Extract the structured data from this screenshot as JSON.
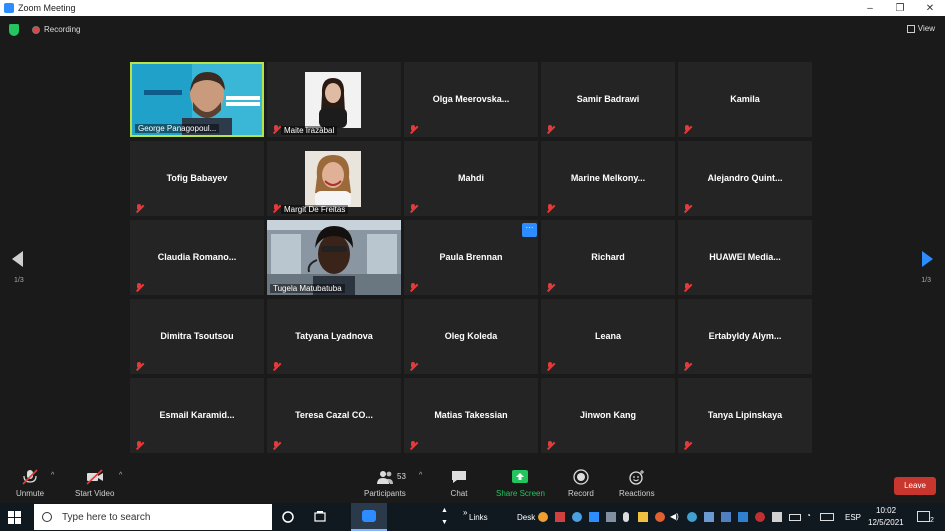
{
  "window": {
    "title": "Zoom Meeting",
    "controls": [
      "–",
      "❐",
      "✕"
    ]
  },
  "topbar": {
    "recording_label": "Recording",
    "view_label": "View"
  },
  "pager": {
    "left_page": "1/3",
    "right_page": "1/3"
  },
  "participants": [
    {
      "name": "George Panagopoul...",
      "video": true
    },
    {
      "name": "Maite Irazabal",
      "video": true
    },
    {
      "name": "Olga  Meerovska...",
      "video": false
    },
    {
      "name": "Samir Badrawi",
      "video": false
    },
    {
      "name": "Kamila",
      "video": false
    },
    {
      "name": "Tofig Babayev",
      "video": false
    },
    {
      "name": "Margit De Freitas",
      "video": true
    },
    {
      "name": "Mahdi",
      "video": false
    },
    {
      "name": "Marine  Melkony...",
      "video": false
    },
    {
      "name": "Alejandro  Quint...",
      "video": false
    },
    {
      "name": "Claudia  Romano...",
      "video": false
    },
    {
      "name": "Tugela Matubatuba",
      "video": true
    },
    {
      "name": "Paula Brennan",
      "video": false
    },
    {
      "name": "Richard",
      "video": false
    },
    {
      "name": "HUAWEI  Media...",
      "video": false
    },
    {
      "name": "Dimitra Tsoutsou",
      "video": false
    },
    {
      "name": "Tatyana Lyadnova",
      "video": false
    },
    {
      "name": "Oleg Koleda",
      "video": false
    },
    {
      "name": "Leana",
      "video": false
    },
    {
      "name": "Ertabyldy  Alym...",
      "video": false
    },
    {
      "name": "Esmail  Karamid...",
      "video": false
    },
    {
      "name": "Teresa  Cazal  CO...",
      "video": false
    },
    {
      "name": "Matias Takessian",
      "video": false
    },
    {
      "name": "Jinwon Kang",
      "video": false
    },
    {
      "name": "Tanya Lipinskaya",
      "video": false
    }
  ],
  "toolbar": {
    "unmute": "Unmute",
    "start_video": "Start Video",
    "participants": "Participants",
    "participants_count": "53",
    "chat": "Chat",
    "share_screen": "Share Screen",
    "record": "Record",
    "reactions": "Reactions",
    "leave": "Leave",
    "more": "···"
  },
  "taskbar": {
    "search_placeholder": "Type here to search",
    "links": "Links",
    "desk": "Desk",
    "lang": "ESP",
    "time": "10:02",
    "date": "12/5/2021",
    "notification_count": "2"
  },
  "colors": {
    "accent": "#2d8cff",
    "active_speaker": "#b6e34a",
    "leave": "#c8362e",
    "share": "#23c55e"
  }
}
